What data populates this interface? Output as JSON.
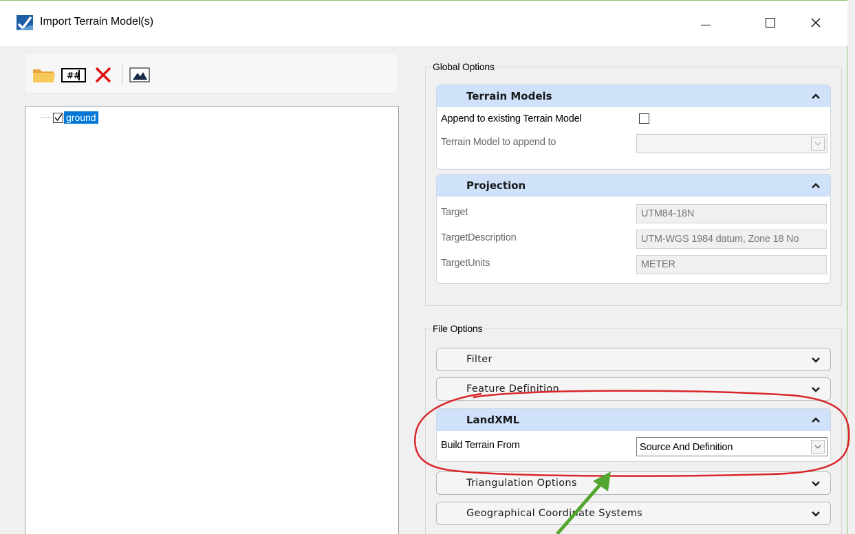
{
  "window": {
    "title": "Import Terrain Model(s)"
  },
  "toolbar": {
    "icons": [
      "open-folder-icon",
      "grid-icon",
      "delete-icon",
      "terrain-preview-icon"
    ]
  },
  "tree": {
    "items": [
      {
        "label": "ground",
        "checked": true,
        "selected": true
      }
    ]
  },
  "global_options": {
    "label": "Global Options",
    "terrain_models": {
      "title": "Terrain Models",
      "append_label": "Append to existing Terrain Model",
      "append_checked": false,
      "append_to_label": "Terrain Model to append to",
      "append_to_value": ""
    },
    "projection": {
      "title": "Projection",
      "rows": [
        {
          "label": "Target",
          "value": "UTM84-18N"
        },
        {
          "label": "TargetDescription",
          "value": "UTM-WGS 1984 datum, Zone 18 No"
        },
        {
          "label": "TargetUnits",
          "value": "METER"
        }
      ]
    }
  },
  "file_options": {
    "label": "File Options",
    "filter": {
      "title": "Filter"
    },
    "feature_definition": {
      "title": "Feature Definition"
    },
    "landxml": {
      "title": "LandXML",
      "build_label": "Build Terrain From",
      "build_value": "Source And Definition"
    },
    "triangulation": {
      "title": "Triangulation Options"
    },
    "geo_coord": {
      "title": "Geographical Coordinate Systems"
    }
  },
  "colors": {
    "panel_header": "#cfe2fa",
    "selection": "#0078d7",
    "annotation_circle": "#d9262b",
    "annotation_arrow": "#55a630"
  }
}
